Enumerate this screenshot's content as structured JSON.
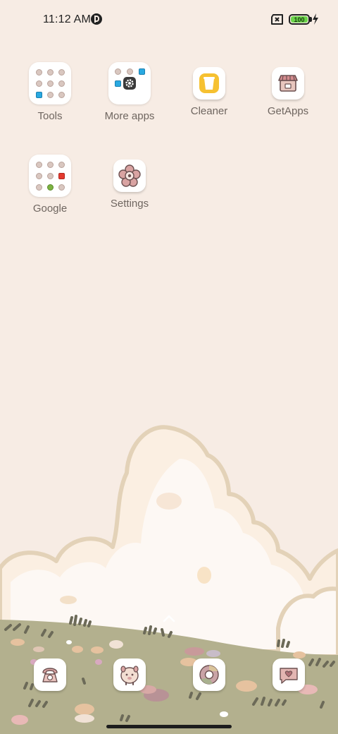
{
  "status_bar": {
    "time": "11:12 AM",
    "battery_level": "100",
    "icons": [
      "p-icon",
      "no-sim-icon",
      "battery-icon",
      "charging-bolt-icon"
    ]
  },
  "home_screen": {
    "apps": [
      {
        "label": "Tools",
        "icon": "folder-icon"
      },
      {
        "label": "More apps",
        "icon": "folder-icon"
      },
      {
        "label": "Cleaner",
        "icon": "trash-can-icon"
      },
      {
        "label": "GetApps",
        "icon": "shop-icon"
      },
      {
        "label": "Google",
        "icon": "folder-icon"
      },
      {
        "label": "Settings",
        "icon": "settings-flower-icon"
      }
    ]
  },
  "dock": {
    "items": [
      {
        "icon": "phone-icon"
      },
      {
        "icon": "sheep-icon"
      },
      {
        "icon": "browser-icon"
      },
      {
        "icon": "message-heart-icon"
      }
    ]
  },
  "colors": {
    "wallpaper_sky": "#f7ece4",
    "cloud": "#fdf7f2",
    "cloud_outline": "#e3d2b8",
    "grass": "#b3b08e",
    "battery_green": "#6bd54a"
  }
}
